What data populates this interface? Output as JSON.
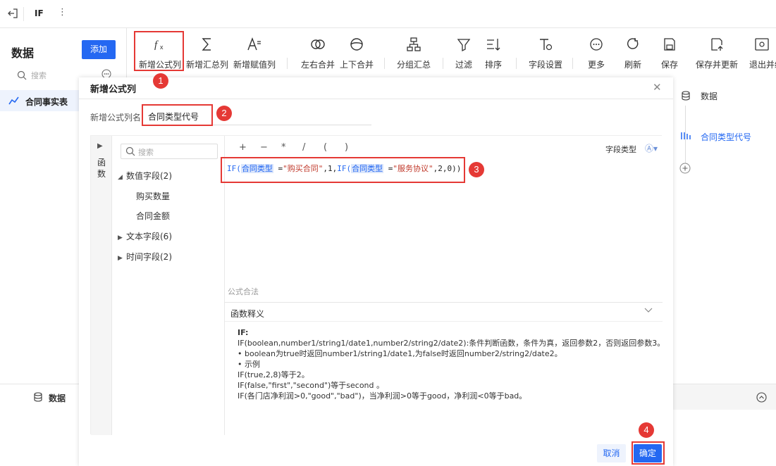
{
  "topbar": {
    "title": "IF",
    "more": "⋮"
  },
  "left_panel": {
    "title": "数据",
    "add_button": "添加",
    "search_placeholder": "搜索",
    "item": "合同事实表",
    "bottom_label": "数据"
  },
  "toolbar": {
    "items": [
      "新增公式列",
      "新增汇总列",
      "新增赋值列",
      "左右合并",
      "上下合并",
      "分组汇总",
      "过滤",
      "排序",
      "字段设置",
      "更多",
      "刷新",
      "保存",
      "保存并更新",
      "退出并编"
    ]
  },
  "right_panel": {
    "data_label": "数据",
    "field_label": "合同类型代号"
  },
  "dialog": {
    "title": "新增公式列",
    "name_label": "新增公式列名",
    "name_value": "合同类型代号",
    "side_label": "函数",
    "search_placeholder": "搜索",
    "tree": [
      {
        "label": "数值字段(2)",
        "children": [
          "购买数量",
          "合同金额"
        ]
      },
      {
        "label": "文本字段(6)"
      },
      {
        "label": "时间字段(2)"
      }
    ],
    "operators": [
      "+",
      "−",
      "*",
      "/",
      "(",
      ")"
    ],
    "field_type_label": "字段类型",
    "formula": {
      "fn1": "IF(",
      "ref1": "合同类型",
      "eq1": " =",
      "str1": "\"购买合同\"",
      "mid1": ",1,",
      "fn2": "IF(",
      "ref2": "合同类型",
      "eq2": " =",
      "str2": "\"服务协议\"",
      "tail": ",2,0))"
    },
    "syntax_label": "公式合法",
    "explain_title": "函数释义",
    "explain_lines": [
      "IF:",
      "IF(boolean,number1/string1/date1,number2/string2/date2):条件判断函数，条件为真，返回参数2，否则返回参数3。",
      "• boolean为true时返回number1/string1/date1,为false时返回number2/string2/date2。",
      "• 示例",
      "IF(true,2,8)等于2。",
      "IF(false,\"first\",\"second\")等于second 。",
      "IF(各门店净利润>0,\"good\",\"bad\")，当净利润>0等于good，净利润<0等于bad。"
    ],
    "cancel_button": "取消",
    "ok_button": "确定"
  },
  "badges": [
    "1",
    "2",
    "3",
    "4"
  ],
  "colors": {
    "accent": "#2468f2",
    "annotation": "#e53935"
  }
}
